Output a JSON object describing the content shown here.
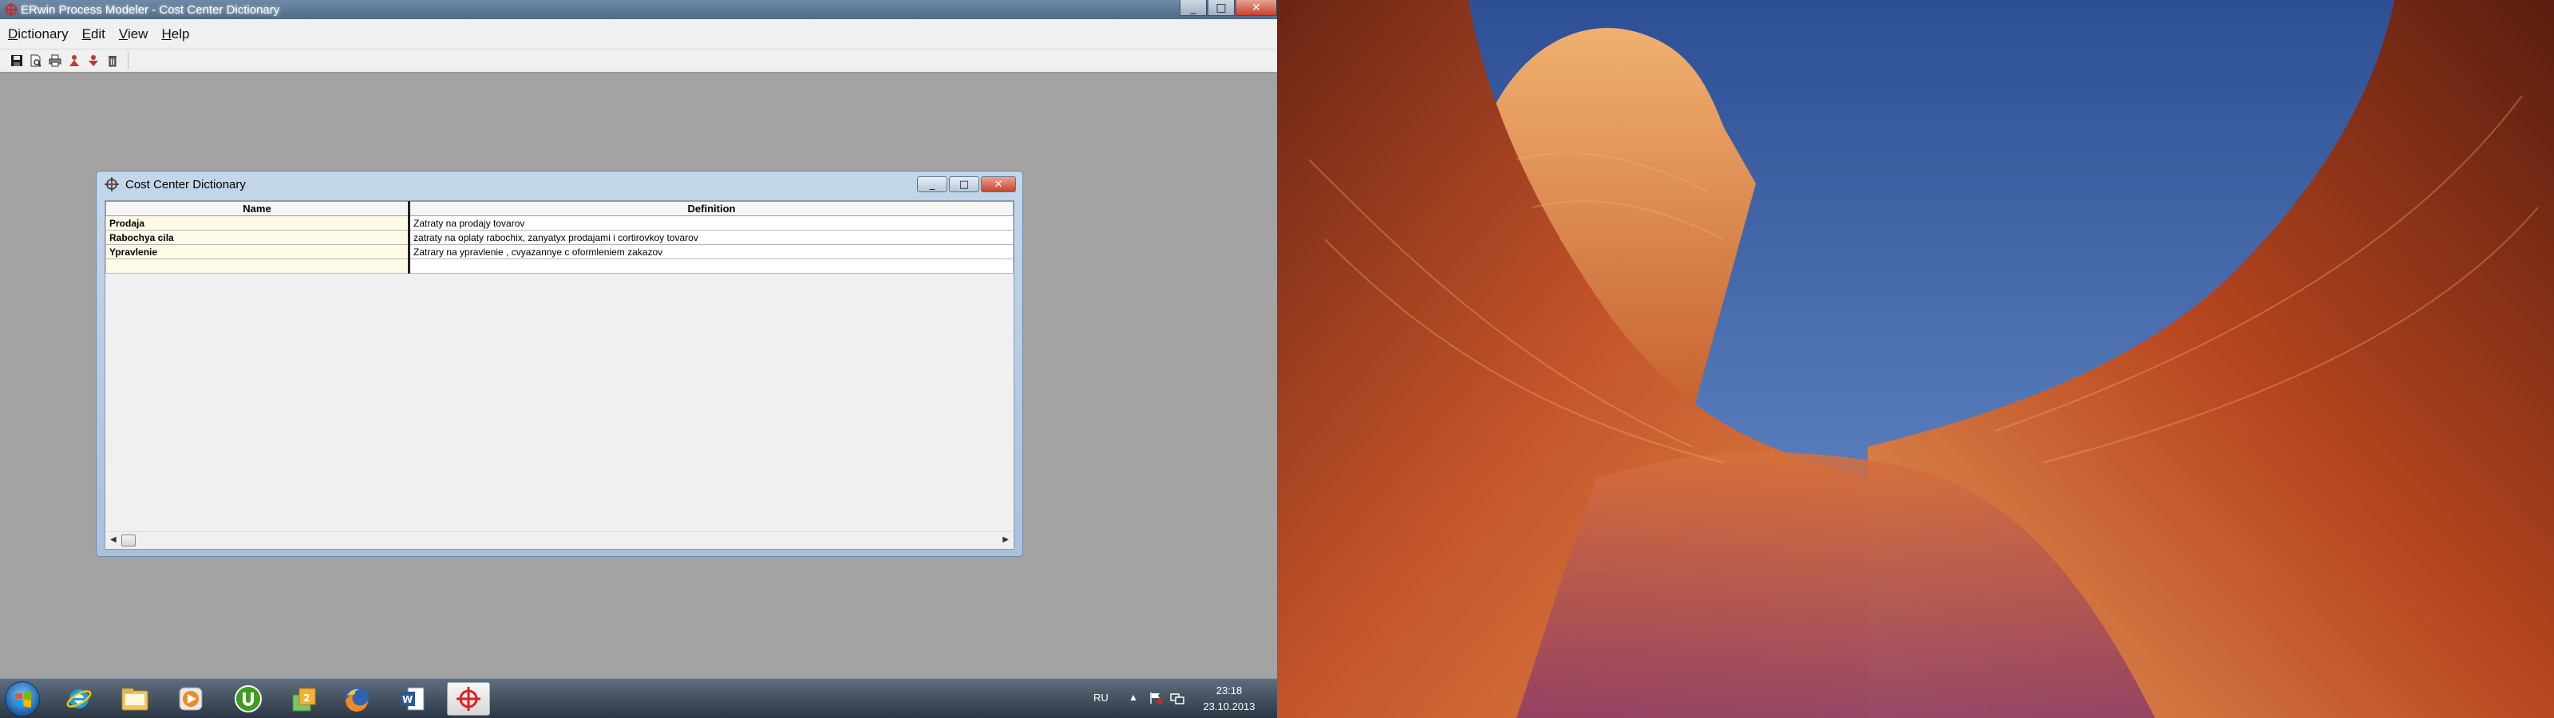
{
  "app": {
    "title": "ERwin Process Modeler - Cost Center Dictionary",
    "window_buttons": {
      "minimize": "_",
      "maximize": "□",
      "close": "✕"
    }
  },
  "menu": {
    "items": [
      {
        "label": "Dictionary",
        "mnemonic": "D",
        "rest": "ictionary"
      },
      {
        "label": "Edit",
        "mnemonic": "E",
        "rest": "dit"
      },
      {
        "label": "View",
        "mnemonic": "V",
        "rest": "iew"
      },
      {
        "label": "Help",
        "mnemonic": "H",
        "rest": "elp"
      }
    ]
  },
  "toolbar": {
    "icons": [
      "save-icon",
      "print-preview-icon",
      "print-icon",
      "sort-ascending-icon",
      "sort-descending-icon",
      "delete-icon"
    ]
  },
  "dialog": {
    "title": "Cost Center Dictionary",
    "columns": {
      "name": "Name",
      "definition": "Definition"
    },
    "rows": [
      {
        "name": "Prodaja",
        "definition": "Zatraty na prodajy tovarov"
      },
      {
        "name": "Rabochya cila",
        "definition": "zatraty na oplaty rabochix, zanyatyx prodajami i cortirovkoy tovarov"
      },
      {
        "name": "Ypravlenie",
        "definition": "Zatrary na ypravlenie , cvyazannye c oformleniem zakazov"
      }
    ],
    "window_buttons": {
      "minimize": "_",
      "maximize": "□",
      "close": "✕"
    }
  },
  "taskbar": {
    "pinned": [
      "windows-start-icon",
      "internet-explorer-icon",
      "file-explorer-icon",
      "media-player-icon",
      "utorrent-icon",
      "stickies-icon",
      "firefox-icon",
      "word-icon",
      "erwin-icon"
    ],
    "active": "erwin-icon",
    "tray": {
      "language": "RU",
      "time": "23:18",
      "date": "23.10.2013"
    }
  },
  "colors": {
    "title_active": "#4f6b88",
    "window_frame": "#a9c1db",
    "name_cell_bg": "#fffae6",
    "workspace_bg": "#a3a3a3",
    "close_button": "#c8412c"
  }
}
